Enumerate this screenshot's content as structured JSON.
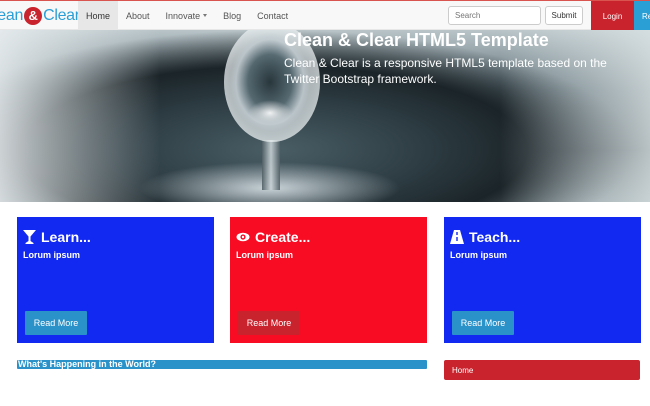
{
  "navbar": {
    "brand_part1": "lean",
    "brand_amp": "&",
    "brand_part2": "Clear",
    "items": [
      {
        "label": "Home",
        "active": true
      },
      {
        "label": "About"
      },
      {
        "label": "Innovate",
        "dropdown": true
      },
      {
        "label": "Blog"
      },
      {
        "label": "Contact"
      }
    ],
    "search_placeholder": "Search",
    "submit_label": "Submit",
    "login_label": "Login",
    "register_label": "Re"
  },
  "hero": {
    "title": "Clean & Clear HTML5 Template",
    "text": "Clean & Clear is a responsive HTML5 template based on the Twitter Bootstrap framework."
  },
  "cards": [
    {
      "title": "Learn...",
      "text": "Lorum ipsum",
      "button": "Read More",
      "icon": "cocktail-icon",
      "color": "#1229f2"
    },
    {
      "title": "Create...",
      "text": "Lorum ipsum",
      "button": "Read More",
      "icon": "eye-icon",
      "color": "#f80c24"
    },
    {
      "title": "Teach...",
      "text": "Lorum ipsum",
      "button": "Read More",
      "icon": "road-icon",
      "color": "#1229f2"
    }
  ],
  "news": {
    "title": "What's Happening in the World?"
  },
  "sidebar": {
    "home_label": "Home"
  },
  "colors": {
    "primary_blue": "#2a9fd6",
    "accent_red": "#c9232d"
  }
}
